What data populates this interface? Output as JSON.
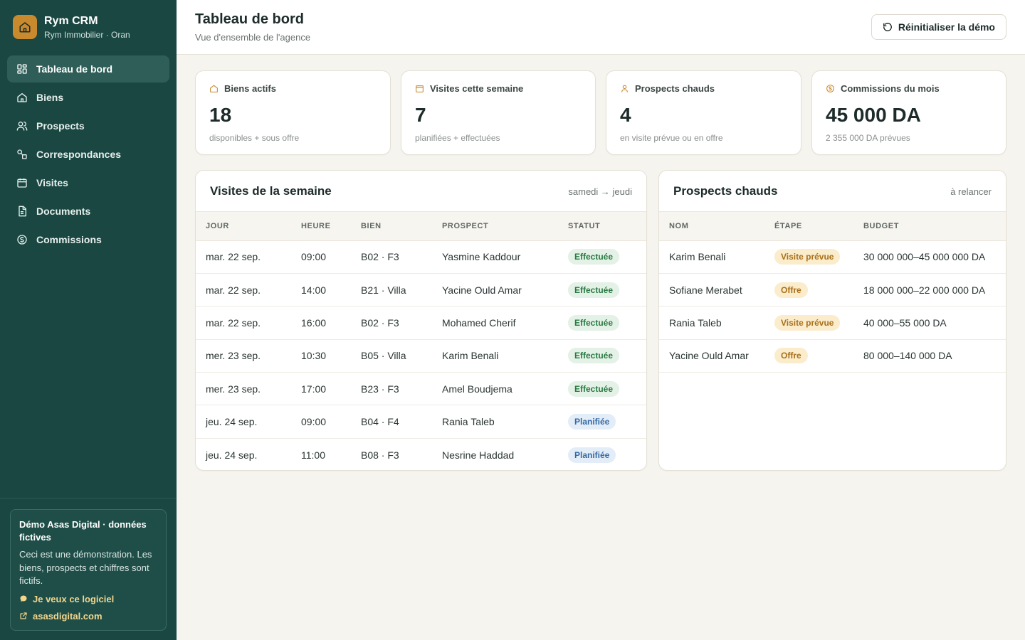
{
  "brand": {
    "name": "Rym CRM",
    "subtitle": "Rym Immobilier · Oran"
  },
  "nav": {
    "items": [
      {
        "label": "Tableau de bord",
        "icon": "dashboard-icon",
        "active": true
      },
      {
        "label": "Biens",
        "icon": "home-icon"
      },
      {
        "label": "Prospects",
        "icon": "users-icon"
      },
      {
        "label": "Correspondances",
        "icon": "match-icon"
      },
      {
        "label": "Visites",
        "icon": "calendar-icon"
      },
      {
        "label": "Documents",
        "icon": "document-icon"
      },
      {
        "label": "Commissions",
        "icon": "coin-icon"
      }
    ]
  },
  "promo": {
    "title": "Démo Asas Digital · données fictives",
    "text": "Ceci est une démonstration. Les biens, prospects et chiffres sont fictifs.",
    "cta": "Je veux ce logiciel",
    "link": "asasdigital.com"
  },
  "header": {
    "title": "Tableau de bord",
    "subtitle": "Vue d'ensemble de l'agence",
    "reset_label": "Réinitialiser la démo"
  },
  "stats": [
    {
      "label": "Biens actifs",
      "value": "18",
      "note": "disponibles + sous offre",
      "icon": "home-icon"
    },
    {
      "label": "Visites cette semaine",
      "value": "7",
      "note": "planifiées + effectuées",
      "icon": "calendar-icon"
    },
    {
      "label": "Prospects chauds",
      "value": "4",
      "note": "en visite prévue ou en offre",
      "icon": "user-icon"
    },
    {
      "label": "Commissions du mois",
      "value": "45 000 DA",
      "note": "2 355 000 DA prévues",
      "icon": "coin-icon"
    }
  ],
  "visits": {
    "title": "Visites de la semaine",
    "range": "samedi → jeudi",
    "columns": [
      "JOUR",
      "HEURE",
      "BIEN",
      "PROSPECT",
      "STATUT"
    ],
    "rows": [
      {
        "day": "mar. 22 sep.",
        "time": "09:00",
        "property": "B02 · F3",
        "prospect": "Yasmine Kaddour",
        "status": "Effectuée"
      },
      {
        "day": "mar. 22 sep.",
        "time": "14:00",
        "property": "B21 · Villa",
        "prospect": "Yacine Ould Amar",
        "status": "Effectuée"
      },
      {
        "day": "mar. 22 sep.",
        "time": "16:00",
        "property": "B02 · F3",
        "prospect": "Mohamed Cherif",
        "status": "Effectuée"
      },
      {
        "day": "mer. 23 sep.",
        "time": "10:30",
        "property": "B05 · Villa",
        "prospect": "Karim Benali",
        "status": "Effectuée"
      },
      {
        "day": "mer. 23 sep.",
        "time": "17:00",
        "property": "B23 · F3",
        "prospect": "Amel Boudjema",
        "status": "Effectuée"
      },
      {
        "day": "jeu. 24 sep.",
        "time": "09:00",
        "property": "B04 · F4",
        "prospect": "Rania Taleb",
        "status": "Planifiée"
      },
      {
        "day": "jeu. 24 sep.",
        "time": "11:00",
        "property": "B08 · F3",
        "prospect": "Nesrine Haddad",
        "status": "Planifiée"
      }
    ]
  },
  "hot": {
    "title": "Prospects chauds",
    "meta": "à relancer",
    "columns": [
      "NOM",
      "ÉTAPE",
      "BUDGET"
    ],
    "rows": [
      {
        "name": "Karim Benali",
        "stage": "Visite prévue",
        "budget": "30 000 000–45 000 000 DA"
      },
      {
        "name": "Sofiane Merabet",
        "stage": "Offre",
        "budget": "18 000 000–22 000 000 DA"
      },
      {
        "name": "Rania Taleb",
        "stage": "Visite prévue",
        "budget": "40 000–55 000 DA"
      },
      {
        "name": "Yacine Ould Amar",
        "stage": "Offre",
        "budget": "80 000–140 000 DA"
      }
    ]
  },
  "colors": {
    "sidebar": "#1a4742",
    "accent": "#c98a2e",
    "done": "#2a7a43",
    "planned": "#3669a3",
    "stage": "#a8701a"
  }
}
